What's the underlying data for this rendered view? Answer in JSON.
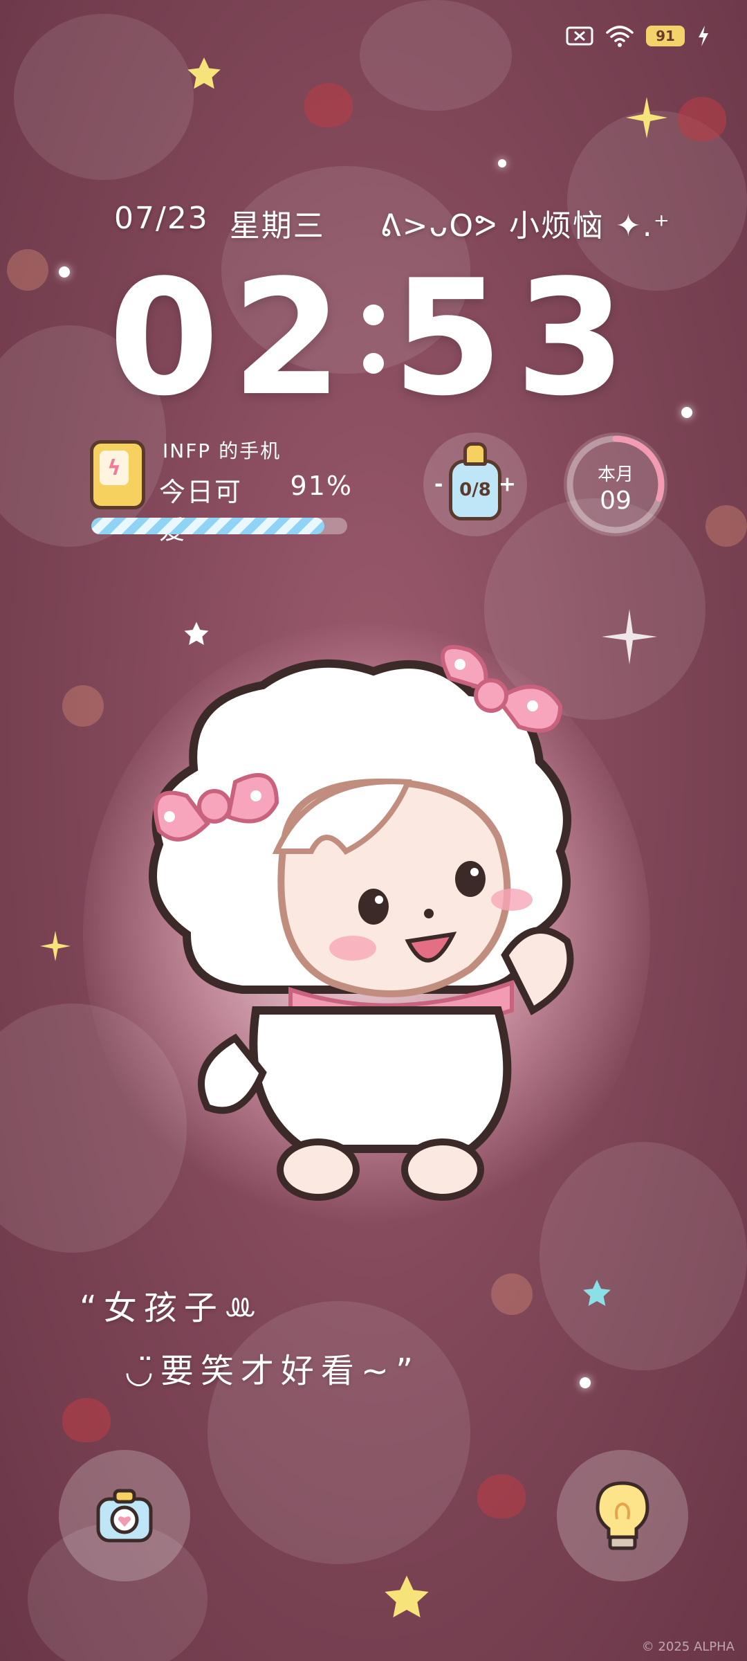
{
  "status_bar": {
    "icons": [
      "signal-off-icon",
      "wifi-icon",
      "battery-icon",
      "charging-bolt-icon"
    ],
    "battery_level": "91",
    "colors": {
      "battery_pill": "#f4d36b"
    }
  },
  "lockscreen": {
    "date": "07/23",
    "weekday": "星期三",
    "mood_text": "ᕕ>ᴗOᕗ 小烦恼 ✦.⁺",
    "clock": {
      "hours": "02",
      "minutes": "53"
    }
  },
  "phone_widget": {
    "owner": "INFP 的手机",
    "mood_label": "今日可爱",
    "percent": "91%",
    "battery_fraction": 0.91
  },
  "water_widget": {
    "minus": "-",
    "count": "0/8",
    "plus": "+"
  },
  "month_widget": {
    "label": "本月",
    "value": "09",
    "progress_fraction": 0.3
  },
  "quote": {
    "line1": "“女孩子ꔛ",
    "line2": "◡̈要笑才好看~”"
  },
  "shortcuts": {
    "left_icon": "camera-icon",
    "right_icon": "flashlight-bulb-icon"
  },
  "copyright": "© 2025 ALPHA",
  "colors": {
    "background": "#7d4556",
    "accent_pink": "#f29bb3",
    "accent_blue": "#8fd4f4",
    "accent_yellow": "#f6d15f"
  }
}
